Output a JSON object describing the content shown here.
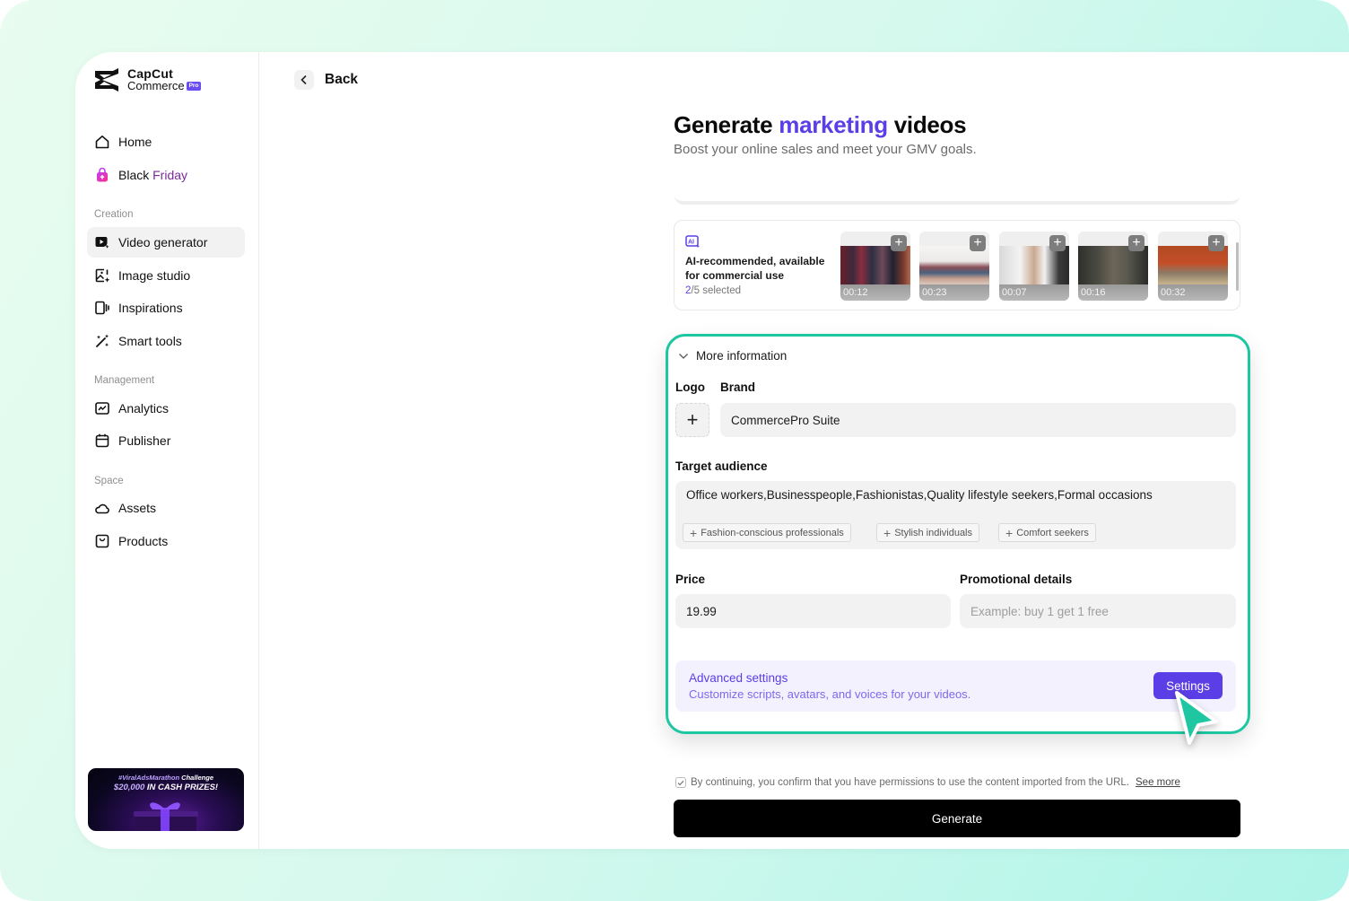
{
  "brand": {
    "name_line1": "CapCut",
    "name_line2": "Commerce",
    "badge": "Pro"
  },
  "sidebar": {
    "top_items": [
      {
        "label": "Home",
        "icon": "home-icon"
      },
      {
        "label_part1": "Black ",
        "label_part2": "Friday",
        "icon": "shopping-bag-icon"
      }
    ],
    "sections": [
      {
        "title": "Creation",
        "items": [
          {
            "label": "Video generator",
            "icon": "video-sparkle-icon",
            "active": true
          },
          {
            "label": "Image studio",
            "icon": "image-sparkle-icon"
          },
          {
            "label": "Inspirations",
            "icon": "inspirations-icon"
          },
          {
            "label": "Smart tools",
            "icon": "magic-wand-icon"
          }
        ]
      },
      {
        "title": "Management",
        "items": [
          {
            "label": "Analytics",
            "icon": "analytics-icon"
          },
          {
            "label": "Publisher",
            "icon": "calendar-icon"
          }
        ]
      },
      {
        "title": "Space",
        "items": [
          {
            "label": "Assets",
            "icon": "cloud-icon"
          },
          {
            "label": "Products",
            "icon": "products-bag-icon"
          }
        ]
      }
    ],
    "promo": {
      "line1_highlight": "#ViralAdsMarathon",
      "line1_rest": " Challenge",
      "line2_amount": "$20,000",
      "line2_rest": " IN CASH PRIZES!"
    }
  },
  "header": {
    "back_label": "Back"
  },
  "main": {
    "title_part1": "Generate ",
    "title_accent": "marketing",
    "title_part2": " videos",
    "subtitle": "Boost your online sales and meet your GMV goals.",
    "ai_card": {
      "description": "AI-recommended, available for commercial use",
      "selected_count": "2",
      "selected_total": "/5 selected",
      "videos": [
        {
          "duration": "00:12",
          "theme": "clothing-rack"
        },
        {
          "duration": "00:23",
          "theme": "shirts-on-hangers"
        },
        {
          "duration": "00:07",
          "theme": "buttoning-shirt"
        },
        {
          "duration": "00:16",
          "theme": "hands-close-up"
        },
        {
          "duration": "00:32",
          "theme": "street-walk"
        }
      ]
    },
    "more_info": {
      "toggle_label": "More information",
      "logo_label": "Logo",
      "brand_label": "Brand",
      "brand_value": "CommercePro Suite",
      "audience_label": "Target audience",
      "audience_value": "Office workers,Businesspeople,Fashionistas,Quality lifestyle seekers,Formal occasions",
      "audience_suggestions": [
        "Fashion-conscious professionals",
        "Stylish individuals",
        "Comfort seekers"
      ],
      "price_label": "Price",
      "price_value": "19.99",
      "promo_label": "Promotional details",
      "promo_placeholder": "Example: buy 1 get 1 free",
      "advanced_title": "Advanced settings",
      "advanced_subtitle": "Customize scripts, avatars, and voices for your videos.",
      "settings_button": "Settings"
    },
    "consent_text": "By continuing, you confirm that you have permissions to use the content imported from the URL.",
    "consent_checked": true,
    "see_more_label": "See more",
    "generate_button": "Generate"
  },
  "colors": {
    "accent": "#5b3ee6",
    "highlight_border": "#1ec7a2",
    "cursor": "#1ec7a2",
    "generate_bg": "#000000"
  }
}
